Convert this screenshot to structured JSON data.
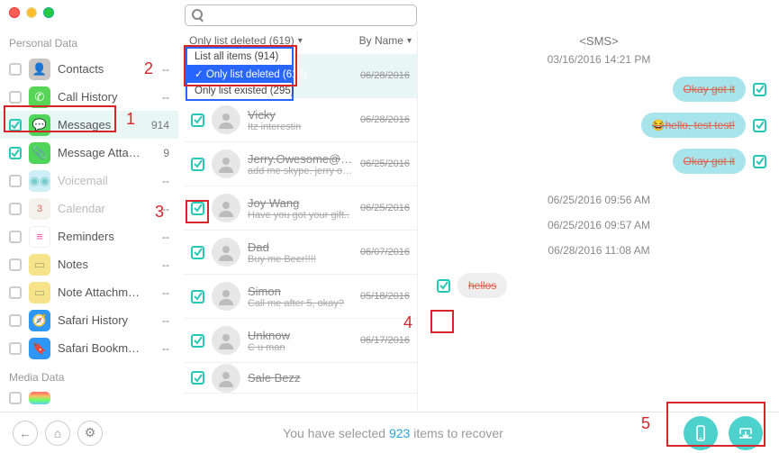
{
  "window": {
    "title": "<SMS>"
  },
  "search": {
    "placeholder": ""
  },
  "sidebar": {
    "header1": "Personal Data",
    "header2": "Media Data",
    "items": [
      {
        "label": "Contacts",
        "count": "--",
        "checked": false,
        "dim": false,
        "iconColor": "#c9c6c3"
      },
      {
        "label": "Call History",
        "count": "--",
        "checked": false,
        "dim": false,
        "iconColor": "#57d557"
      },
      {
        "label": "Messages",
        "count": "914",
        "checked": true,
        "dim": false,
        "iconColor": "#4fd65a",
        "selected": true
      },
      {
        "label": "Message Attac…",
        "count": "9",
        "checked": true,
        "dim": false,
        "iconColor": "#4fd65a"
      },
      {
        "label": "Voicemail",
        "count": "--",
        "checked": false,
        "dim": true,
        "iconColor": "#cfeff6"
      },
      {
        "label": "Calendar",
        "count": "--",
        "checked": false,
        "dim": true,
        "iconColor": "#f4f1ec"
      },
      {
        "label": "Reminders",
        "count": "--",
        "checked": false,
        "dim": false,
        "iconColor": "#f6e9b8"
      },
      {
        "label": "Notes",
        "count": "--",
        "checked": false,
        "dim": false,
        "iconColor": "#f7e389"
      },
      {
        "label": "Note Attachment",
        "count": "--",
        "checked": false,
        "dim": false,
        "iconColor": "#f7e389"
      },
      {
        "label": "Safari History",
        "count": "--",
        "checked": false,
        "dim": false,
        "iconColor": "#2e96f5"
      },
      {
        "label": "Safari Bookmarks",
        "count": "--",
        "checked": false,
        "dim": false,
        "iconColor": "#2e96f5"
      }
    ]
  },
  "filter": {
    "current": "Only list deleted (619)",
    "sortLabel": "By Name",
    "options": [
      "List all items (914)",
      "Only list deleted (619)",
      "Only list existed (295)"
    ],
    "selectedIndex": 1
  },
  "threads": [
    {
      "name": "",
      "preview": "",
      "date": "06/28/2016"
    },
    {
      "name": "Vicky",
      "preview": "Itz interestin",
      "date": "06/28/2016"
    },
    {
      "name": "Jerry.Owesome@aol.com",
      "preview": "add me skype. jerry ow…",
      "date": "06/25/2016"
    },
    {
      "name": "Joy Wang",
      "preview": "Have you got your gift..",
      "date": "06/25/2016"
    },
    {
      "name": "Dad",
      "preview": "Buy me Beer!!!!",
      "date": "06/07/2016"
    },
    {
      "name": "Simon",
      "preview": "Call me after 5, okay?",
      "date": "05/18/2016"
    },
    {
      "name": "Unknow",
      "preview": "C u man",
      "date": "06/17/2016"
    },
    {
      "name": "Sale Bezz",
      "preview": "",
      "date": ""
    }
  ],
  "detail": {
    "title": "<SMS>",
    "headerTime": "03/16/2016 14:21 PM",
    "bubbles": [
      {
        "side": "right",
        "text": "Okay got it"
      },
      {
        "side": "right",
        "text": "😂hello, test test!"
      },
      {
        "side": "right",
        "text": "Okay got it"
      }
    ],
    "times": [
      "06/25/2016 09:56 AM",
      "06/25/2016 09:57 AM",
      "06/28/2016 11:08 AM"
    ],
    "incoming": {
      "text": "hellos"
    }
  },
  "footer": {
    "prefix": "You have selected ",
    "count": "923",
    "suffix": " items to recover"
  },
  "annotations": {
    "n1": "1",
    "n2": "2",
    "n3": "3",
    "n4": "4",
    "n5": "5"
  }
}
